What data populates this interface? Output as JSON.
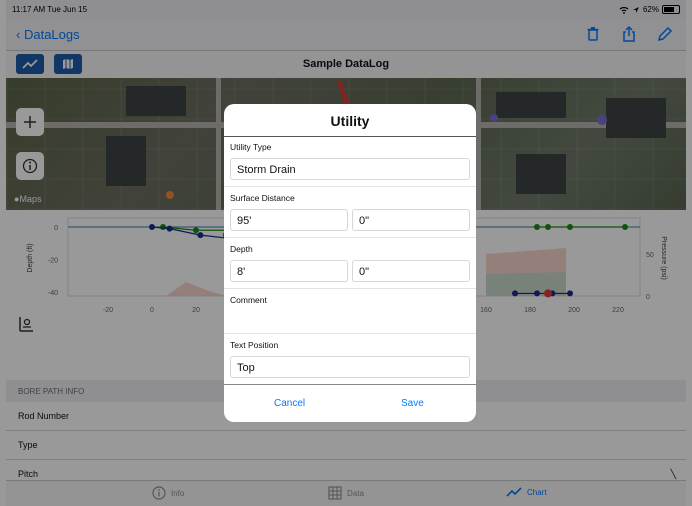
{
  "status": {
    "time": "11:17 AM  Tue Jun 15",
    "battery": "62%"
  },
  "nav": {
    "back_label": "DataLogs"
  },
  "toolbar": {
    "title": "Sample DataLog"
  },
  "map": {
    "attribution": "Maps"
  },
  "chart_data": {
    "type": "line",
    "x_ticks": [
      "-20",
      "0",
      "20",
      "160",
      "180",
      "200",
      "220"
    ],
    "y_left_ticks": [
      "0",
      "-20",
      "-40"
    ],
    "y_right_ticks": [
      "50",
      "0"
    ],
    "ylabel_left": "Depth (ft)",
    "ylabel_right": "Pressure (psi)",
    "series": [
      {
        "points": [
          [
            5,
            0
          ],
          [
            20,
            -2
          ],
          [
            35,
            -2
          ]
        ],
        "color": "#1a8a1a"
      },
      {
        "points": [
          [
            0,
            0
          ],
          [
            8,
            -1
          ],
          [
            22,
            -5
          ],
          [
            35,
            -7
          ]
        ],
        "color": "#1a2a8c"
      },
      {
        "points": [
          [
            175,
            0
          ],
          [
            180,
            0
          ],
          [
            190,
            0
          ],
          [
            215,
            0
          ]
        ],
        "color": "#1a8a1a"
      },
      {
        "points": [
          [
            165,
            -41
          ],
          [
            175,
            -41
          ],
          [
            182,
            -41
          ],
          [
            190,
            -41
          ]
        ],
        "color": "#1a2a8c"
      }
    ],
    "colors": {
      "green": "#1a8a1a",
      "navy": "#1a2a8c",
      "red": "#e03a3a"
    }
  },
  "bore_path": {
    "header": "BORE PATH INFO",
    "rows": [
      "Rod Number",
      "Type",
      "Pitch"
    ]
  },
  "tabs": [
    {
      "label": "Info",
      "icon": "info-icon"
    },
    {
      "label": "Data",
      "icon": "grid-icon"
    },
    {
      "label": "Chart",
      "icon": "chart-line-icon"
    }
  ],
  "dialog": {
    "title": "Utility",
    "utility_type_label": "Utility Type",
    "utility_type_value": "Storm Drain",
    "surface_distance_label": "Surface Distance",
    "surface_distance_ft": "95'",
    "surface_distance_in": "0\"",
    "depth_label": "Depth",
    "depth_ft": "8'",
    "depth_in": "0\"",
    "comment_label": "Comment",
    "text_position_label": "Text Position",
    "text_position_value": "Top",
    "cancel_label": "Cancel",
    "save_label": "Save"
  }
}
